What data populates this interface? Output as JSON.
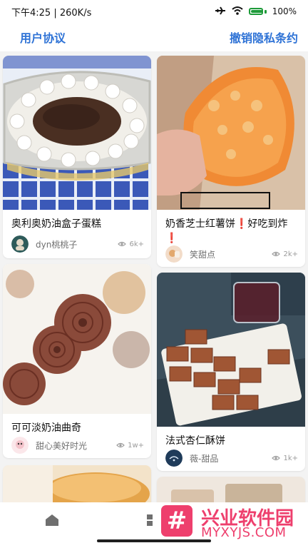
{
  "status_bar": {
    "time": "下午4:25",
    "network_speed": "260K/s",
    "battery_percent": "100%"
  },
  "top_bar": {
    "left_link": "用户协议",
    "right_link": "撤销隐私条约"
  },
  "feed": [
    {
      "title": "奥利奥奶油盒子蛋糕",
      "author": "dyn桃桃子",
      "views": "6k+"
    },
    {
      "title": "奶香芝士红薯饼❗️好吃到炸❗️",
      "author": "笑甜点",
      "views": "2k+"
    },
    {
      "title": "可可淡奶油曲奇",
      "author": "甜心美好时光",
      "views": "1w+"
    },
    {
      "title": "法式杏仁酥饼",
      "author": "薇-甜品",
      "views": "1k+"
    }
  ],
  "watermark": {
    "brand": "兴业软件园",
    "url": "MYXYJS.COM"
  },
  "colors": {
    "accent_blue": "#2f73d6",
    "watermark_pink": "#ee3f6d",
    "battery_green": "#1e9b3a"
  }
}
